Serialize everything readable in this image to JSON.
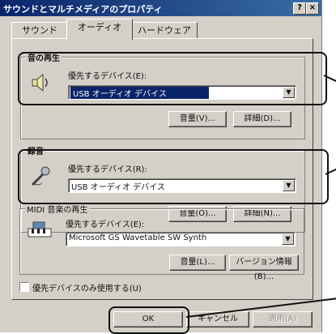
{
  "window": {
    "title": "サウンドとマルチメディアのプロパティ",
    "help_button": "?",
    "close_button": "×"
  },
  "tabs": [
    {
      "label": "サウンド"
    },
    {
      "label": "オーディオ"
    },
    {
      "label": "ハードウェア"
    }
  ],
  "playback": {
    "group_title": "音の再生",
    "device_label": "優先するデバイス(E):",
    "device_value": "USB オーディオ デバイス",
    "volume_button": "音量(V)...",
    "advanced_button": "詳細(D)..."
  },
  "recording": {
    "group_title": "録音",
    "device_label": "優先するデバイス(R):",
    "device_value": "USB オーディオ デバイス",
    "volume_button": "音量(O)...",
    "advanced_button": "詳細(N)..."
  },
  "midi": {
    "group_title": "MIDI 音楽の再生",
    "device_label": "優先するデバイス(E):",
    "device_value": "Microsoft GS Wavetable SW Synth",
    "volume_button": "音量(L)...",
    "about_button": "バージョン情報(B)..."
  },
  "options": {
    "preferred_only_label": "優先デバイスのみ使用する(U)",
    "preferred_only_checked": false
  },
  "footer": {
    "ok_button": "OK",
    "cancel_button": "キャンセル",
    "apply_button": "適用(A)"
  }
}
